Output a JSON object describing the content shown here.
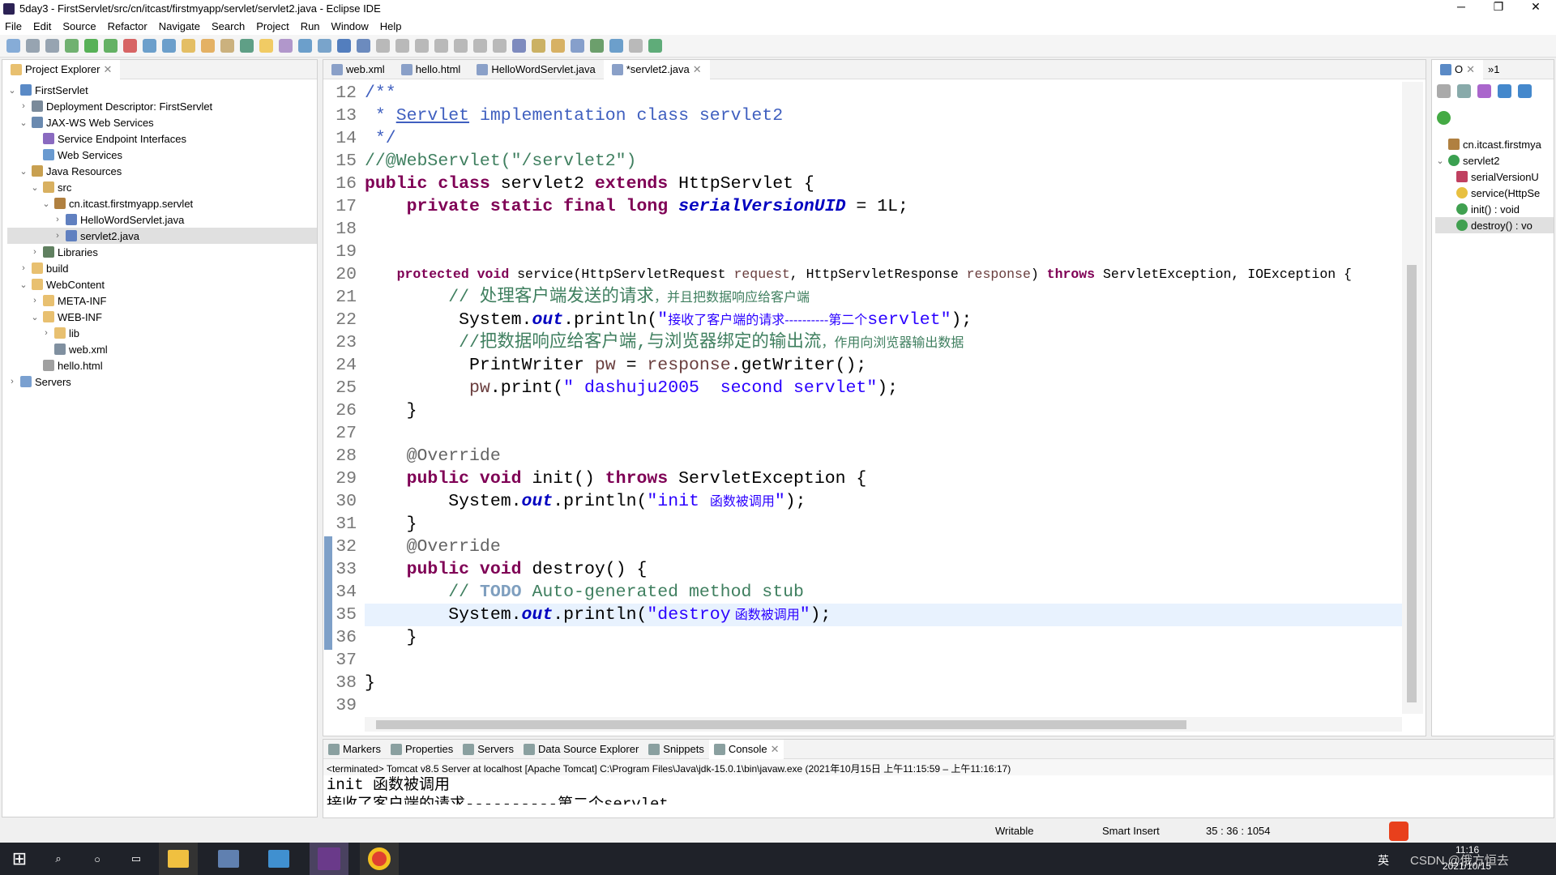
{
  "window": {
    "title": "5day3 - FirstServlet/src/cn/itcast/firstmyapp/servlet/servlet2.java - Eclipse IDE",
    "minimize": "─",
    "restore": "❐",
    "close": "✕"
  },
  "menu": [
    "File",
    "Edit",
    "Source",
    "Refactor",
    "Navigate",
    "Search",
    "Project",
    "Run",
    "Window",
    "Help"
  ],
  "project_explorer": {
    "title": "Project Explorer",
    "items": [
      {
        "label": "FirstServlet",
        "depth": 0,
        "chev": "v",
        "icon": "project-icon",
        "color": "#5a8ac6"
      },
      {
        "label": "Deployment Descriptor: FirstServlet",
        "depth": 1,
        "chev": ">",
        "icon": "descriptor-icon",
        "color": "#7a8a9a"
      },
      {
        "label": "JAX-WS Web Services",
        "depth": 1,
        "chev": "v",
        "icon": "webservice-icon",
        "color": "#6a8ab0"
      },
      {
        "label": "Service Endpoint Interfaces",
        "depth": 2,
        "chev": "",
        "icon": "interface-icon",
        "color": "#8a6ac0"
      },
      {
        "label": "Web Services",
        "depth": 2,
        "chev": "",
        "icon": "webservice-icon",
        "color": "#6a9ad0"
      },
      {
        "label": "Java Resources",
        "depth": 1,
        "chev": "v",
        "icon": "java-resources-icon",
        "color": "#c8a050"
      },
      {
        "label": "src",
        "depth": 2,
        "chev": "v",
        "icon": "source-folder-icon",
        "color": "#d8b060"
      },
      {
        "label": "cn.itcast.firstmyapp.servlet",
        "depth": 3,
        "chev": "v",
        "icon": "package-icon",
        "color": "#b08040"
      },
      {
        "label": "HelloWordServlet.java",
        "depth": 4,
        "chev": ">",
        "icon": "java-file-icon",
        "color": "#6080c0"
      },
      {
        "label": "servlet2.java",
        "depth": 4,
        "chev": ">",
        "icon": "java-file-icon",
        "color": "#6080c0",
        "selected": true
      },
      {
        "label": "Libraries",
        "depth": 2,
        "chev": ">",
        "icon": "library-icon",
        "color": "#608060"
      },
      {
        "label": "build",
        "depth": 1,
        "chev": ">",
        "icon": "folder-icon",
        "color": "#e8c070"
      },
      {
        "label": "WebContent",
        "depth": 1,
        "chev": "v",
        "icon": "folder-icon",
        "color": "#e8c070"
      },
      {
        "label": "META-INF",
        "depth": 2,
        "chev": ">",
        "icon": "folder-icon",
        "color": "#e8c070"
      },
      {
        "label": "WEB-INF",
        "depth": 2,
        "chev": "v",
        "icon": "folder-icon",
        "color": "#e8c070"
      },
      {
        "label": "lib",
        "depth": 3,
        "chev": ">",
        "icon": "folder-icon",
        "color": "#e8c070"
      },
      {
        "label": "web.xml",
        "depth": 3,
        "chev": "",
        "icon": "xml-file-icon",
        "color": "#8090a0"
      },
      {
        "label": "hello.html",
        "depth": 2,
        "chev": "",
        "icon": "html-file-icon",
        "color": "#a0a0a0"
      },
      {
        "label": "Servers",
        "depth": 0,
        "chev": ">",
        "icon": "folder-icon",
        "color": "#7aa0d0"
      }
    ]
  },
  "editor": {
    "tabs": [
      {
        "label": "web.xml"
      },
      {
        "label": "hello.html"
      },
      {
        "label": "HelloWordServlet.java"
      },
      {
        "label": "*servlet2.java",
        "active": true
      }
    ],
    "first_line": 12,
    "lines": [
      [
        [
          "/**",
          "jd"
        ]
      ],
      [
        [
          " * ",
          "jd"
        ],
        [
          "Servlet",
          "jd u"
        ],
        [
          " implementation class servlet2",
          "jd"
        ]
      ],
      [
        [
          " */",
          "jd"
        ]
      ],
      [
        [
          "//@WebServlet(\"/servlet2\")",
          "cm"
        ]
      ],
      [
        [
          "public class ",
          "kw"
        ],
        [
          "servlet2 ",
          ""
        ],
        [
          "extends ",
          "kw"
        ],
        [
          "HttpServlet {",
          ""
        ]
      ],
      [
        [
          "    private static final long ",
          "kw"
        ],
        [
          "serialVersionUID",
          "fi"
        ],
        [
          " = 1L;",
          ""
        ]
      ],
      [],
      [],
      [
        [
          "    protected void ",
          "kw"
        ],
        [
          "service(HttpServletRequest ",
          ""
        ],
        [
          "request",
          "pa"
        ],
        [
          ", HttpServletResponse ",
          ""
        ],
        [
          "response",
          "pa"
        ],
        [
          ") ",
          ""
        ],
        [
          "throws ",
          "kw"
        ],
        [
          "ServletException, IOException {",
          ""
        ]
      ],
      [
        [
          "        // 处理客户端发送的请求",
          "cm"
        ],
        [
          "，并且把数据响应给客户端",
          "cm cjk"
        ]
      ],
      [
        [
          "         System.",
          ""
        ],
        [
          "out",
          "fi"
        ],
        [
          ".println(",
          ""
        ],
        [
          "\"",
          "st"
        ],
        [
          "接收了客户端的请求----------第二个",
          "st cjk"
        ],
        [
          "servlet\"",
          "st"
        ],
        [
          ");",
          ""
        ]
      ],
      [
        [
          "         //把数据响应给客户端,与浏览器绑定的输出流",
          "cm"
        ],
        [
          "，作用向浏览器输出数据",
          "cm cjk"
        ]
      ],
      [
        [
          "          PrintWriter ",
          ""
        ],
        [
          "pw",
          "pa"
        ],
        [
          " = ",
          ""
        ],
        [
          "response",
          "pa"
        ],
        [
          ".getWriter();",
          ""
        ]
      ],
      [
        [
          "          ",
          ""
        ],
        [
          "pw",
          "pa"
        ],
        [
          ".print(",
          ""
        ],
        [
          "\" dashuju2005  second servlet\"",
          "st"
        ],
        [
          ");",
          ""
        ]
      ],
      [
        [
          "    }",
          ""
        ]
      ],
      [],
      [
        [
          "    @Override",
          "an"
        ]
      ],
      [
        [
          "    public void ",
          "kw"
        ],
        [
          "init() ",
          ""
        ],
        [
          "throws ",
          "kw"
        ],
        [
          "ServletException {",
          ""
        ]
      ],
      [
        [
          "        System.",
          ""
        ],
        [
          "out",
          "fi"
        ],
        [
          ".println(",
          ""
        ],
        [
          "\"init ",
          "st"
        ],
        [
          "函数被调用",
          "st cjk"
        ],
        [
          "\"",
          "st"
        ],
        [
          ");",
          ""
        ]
      ],
      [
        [
          "    }",
          ""
        ]
      ],
      [
        [
          "    @Override",
          "an"
        ]
      ],
      [
        [
          "    public void ",
          "kw"
        ],
        [
          "destroy() {",
          ""
        ]
      ],
      [
        [
          "        // ",
          "cm"
        ],
        [
          "TODO",
          "todo"
        ],
        [
          " Auto-generated method stub",
          "cm"
        ]
      ],
      [
        [
          "        System.",
          ""
        ],
        [
          "out",
          "fi"
        ],
        [
          ".println(",
          ""
        ],
        [
          "\"destroy",
          "st"
        ],
        [
          " 函数被调用",
          "st cjk"
        ],
        [
          "\"",
          "st"
        ],
        [
          ");",
          ""
        ]
      ],
      [
        [
          "    }",
          ""
        ]
      ],
      [],
      [
        [
          "}",
          ""
        ]
      ],
      []
    ]
  },
  "outline": {
    "tab": "O",
    "tab2": "»1",
    "items": [
      {
        "label": "cn.itcast.firstmya",
        "icon": "package-icon",
        "color": "#b08040",
        "depth": 0
      },
      {
        "label": "servlet2",
        "icon": "class-icon",
        "color": "#3aa050",
        "depth": 0,
        "chev": "v"
      },
      {
        "label": "serialVersionU",
        "icon": "field-icon",
        "color": "#c04060",
        "depth": 1
      },
      {
        "label": "service(HttpSe",
        "icon": "method-protected-icon",
        "color": "#e8c040",
        "depth": 1
      },
      {
        "label": "init() : void",
        "icon": "method-public-icon",
        "color": "#40a050",
        "depth": 1
      },
      {
        "label": "destroy() : vo",
        "icon": "method-public-icon",
        "color": "#40a050",
        "depth": 1,
        "selected": true
      }
    ]
  },
  "bottom": {
    "tabs": [
      "Markers",
      "Properties",
      "Servers",
      "Data Source Explorer",
      "Snippets",
      "Console"
    ],
    "console_header": "<terminated> Tomcat v8.5 Server at localhost [Apache Tomcat] C:\\Program Files\\Java\\jdk-15.0.1\\bin\\javaw.exe  (2021年10月15日 上午11:15:59 – 上午11:16:17)",
    "console_lines": [
      "init 函数被调用",
      "接收了客户端的请求----------第二个servlet"
    ]
  },
  "status": {
    "writable": "Writable",
    "insert_mode": "Smart Insert",
    "position": "35 : 36 : 1054"
  },
  "taskbar": {
    "time": "11:16",
    "date": "2021/10/15",
    "ime": "英",
    "watermark": "CSDN @俄方恒去"
  }
}
